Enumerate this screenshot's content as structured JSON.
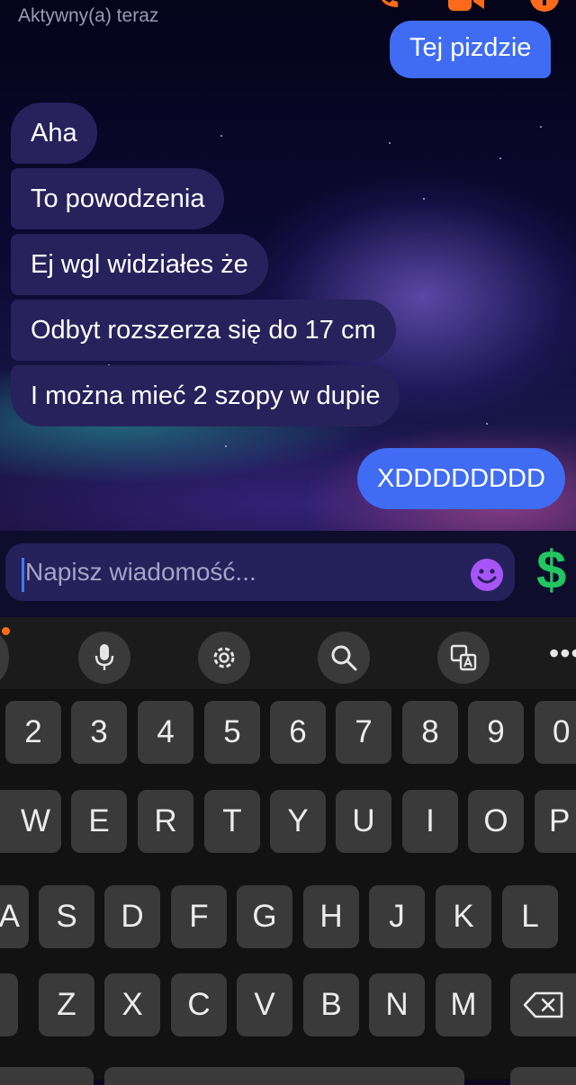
{
  "header": {
    "status": "Aktywny(a) teraz"
  },
  "messages": [
    {
      "direction": "outgoing",
      "text": "Tej pizdzie"
    },
    {
      "direction": "incoming",
      "text": "Aha"
    },
    {
      "direction": "incoming",
      "text": "To powodzenia"
    },
    {
      "direction": "incoming",
      "text": "Ej wgl widziałes że"
    },
    {
      "direction": "incoming",
      "text": "Odbyt rozszerza się do 17 cm"
    },
    {
      "direction": "incoming",
      "text": "I można mieć 2 szopy w dupie"
    },
    {
      "direction": "outgoing",
      "text": "XDDDDDDDD"
    }
  ],
  "composer": {
    "placeholder": "Napisz wiadomość...",
    "value": "",
    "emoji_icon": "emoji-icon",
    "send_icon": "dollar-sign-icon"
  },
  "keyboard": {
    "toolbar": [
      "microphone-icon",
      "settings-icon",
      "search-icon",
      "translate-icon",
      "more-icon"
    ],
    "row_numbers": [
      "2",
      "3",
      "4",
      "5",
      "6",
      "7",
      "8",
      "9",
      "0"
    ],
    "row_top": [
      "W",
      "E",
      "R",
      "T",
      "Y",
      "U",
      "I",
      "O",
      "P"
    ],
    "row_middle": [
      "A",
      "S",
      "D",
      "F",
      "G",
      "H",
      "J",
      "K",
      "L"
    ],
    "row_bottom": [
      "Z",
      "X",
      "C",
      "V",
      "B",
      "N",
      "M"
    ]
  },
  "colors": {
    "incoming_bubble": "#27225c",
    "outgoing_bubble": "#3f6cf2",
    "emoji_purple": "#a855f7",
    "dollar_green": "#22c55e",
    "key_background": "#3a3a3a",
    "toolbar_dot": "#ff6a1a"
  }
}
